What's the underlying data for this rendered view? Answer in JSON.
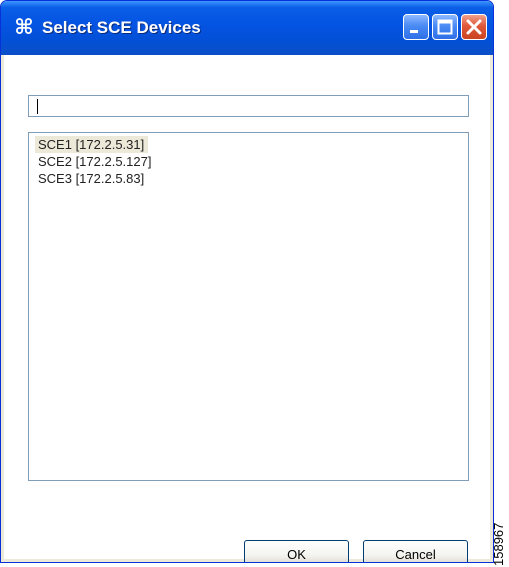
{
  "window": {
    "title": "Select SCE Devices",
    "icon": "command-icon"
  },
  "titlebar_buttons": [
    "minimize-icon",
    "maximize-icon",
    "close-icon"
  ],
  "filter": {
    "value": "",
    "placeholder": ""
  },
  "devices": {
    "items": [
      {
        "label": "SCE1 [172.2.5.31]",
        "selected": true
      },
      {
        "label": "SCE2 [172.2.5.127]",
        "selected": false
      },
      {
        "label": "SCE3 [172.2.5.83]",
        "selected": false
      }
    ]
  },
  "buttons": {
    "ok_label": "OK",
    "cancel_label": "Cancel"
  },
  "figure_number": "158967",
  "colors": {
    "titlebar": "#0554e3",
    "window_border": "#0831d9",
    "close_button": "#e0583a",
    "selection": "#ece9d8",
    "input_border": "#7f9db9"
  }
}
